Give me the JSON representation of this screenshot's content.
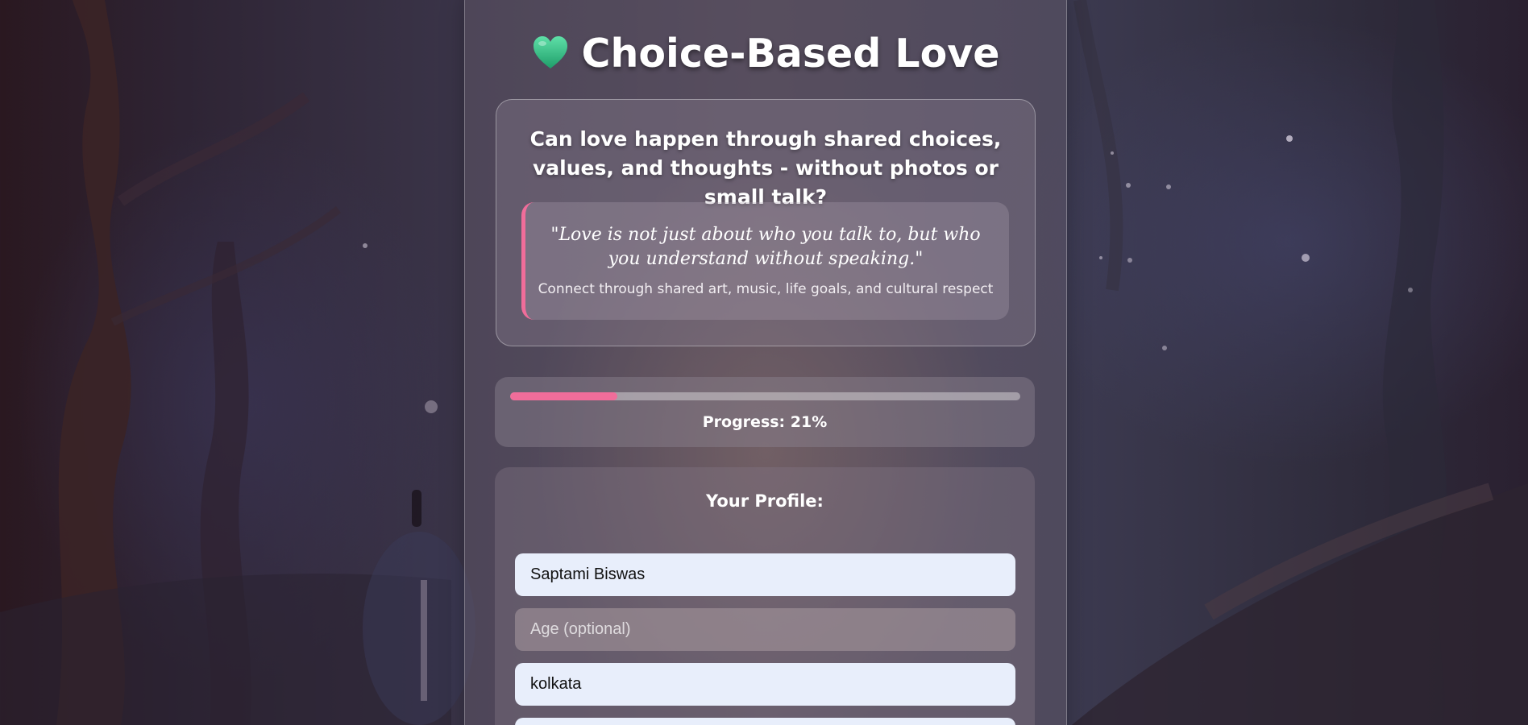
{
  "app": {
    "title": "Choice-Based Love",
    "title_icon": "green-heart-icon",
    "accent_color": "#f06d9a"
  },
  "intro": {
    "question": "Can love happen through shared choices, values, and thoughts - without photos or small talk?",
    "quote": "\"Love is not just about who you talk to, but who you understand without speaking.\"",
    "subtitle": "Connect through shared art, music, life goals, and cultural respect"
  },
  "progress": {
    "value_percent": 21,
    "label": "Progress: 21%"
  },
  "profile": {
    "heading": "Your Profile:",
    "name_value": "Saptami Biswas",
    "age_value": "",
    "age_placeholder": "Age (optional)",
    "city_value": "kolkata"
  }
}
